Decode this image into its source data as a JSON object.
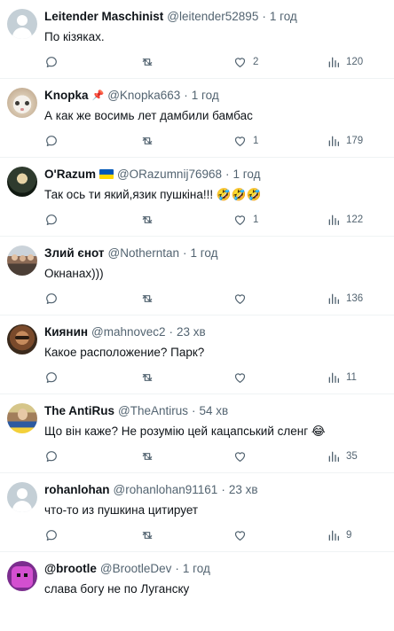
{
  "tweets": [
    {
      "name": "Leitender Maschinist",
      "badge": "",
      "flag": false,
      "handle": "@leitender52895",
      "time": "1 год",
      "text": "По кізяках.",
      "likes": "2",
      "views": "120"
    },
    {
      "name": "Knopka",
      "badge": "📌",
      "flag": false,
      "handle": "@Knopka663",
      "time": "1 год",
      "text": "А как же восимь лет дамбили бамбас",
      "likes": "1",
      "views": "179"
    },
    {
      "name": "O'Razum",
      "badge": "",
      "flag": true,
      "handle": "@ORazumnij76968",
      "time": "1 год",
      "text": "Так ось ти який,язик пушкіна!!! 🤣🤣🤣",
      "likes": "1",
      "views": "122"
    },
    {
      "name": "Злий єнот",
      "badge": "",
      "flag": false,
      "handle": "@Notherntan",
      "time": "1 год",
      "text": "Окнанах)))",
      "likes": "",
      "views": "136"
    },
    {
      "name": "Киянин",
      "badge": "",
      "flag": false,
      "handle": "@mahnovec2",
      "time": "23 хв",
      "text": "Какое расположение? Парк?",
      "likes": "",
      "views": "11"
    },
    {
      "name": "The AntiRus",
      "badge": "",
      "flag": false,
      "handle": "@TheAntirus",
      "time": "54 хв",
      "text": "Що він каже? Не розумію цей кацапський сленг 😂",
      "likes": "",
      "views": "35"
    },
    {
      "name": "rohanlohan",
      "badge": "",
      "flag": false,
      "handle": "@rohanlohan91161",
      "time": "23 хв",
      "text": "что-то из пушкина цитирует",
      "likes": "",
      "views": "9"
    },
    {
      "name": "@brootle",
      "badge": "",
      "flag": false,
      "handle": "@BrootleDev",
      "time": "1 год",
      "text": "слава богу не по Луганску",
      "likes": "",
      "views": ""
    }
  ],
  "separator": "·",
  "icons": {
    "reply": "reply-icon",
    "retweet": "retweet-icon",
    "like": "heart-icon",
    "views": "views-icon"
  }
}
